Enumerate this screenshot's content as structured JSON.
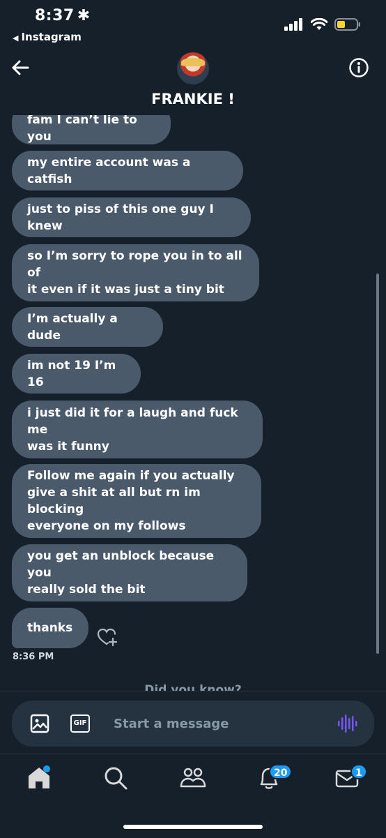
{
  "status_bar": {
    "time": "8:37",
    "back_app": "Instagram"
  },
  "header": {
    "contact_name": "FRANKIE !"
  },
  "messages": [
    {
      "text": "fam I can’t lie to you"
    },
    {
      "text": "my entire account was a catfish"
    },
    {
      "text": "just to piss of this one guy I knew"
    },
    {
      "text": "so I’m sorry to rope you in to all of\nit even if it was just a tiny bit"
    },
    {
      "text": "I’m actually a dude"
    },
    {
      "text": "im not 19 I’m 16"
    },
    {
      "text": "i just did it for a laugh and fuck me\nwas it funny"
    },
    {
      "text": "Follow me again if you actually\ngive a shit at all but rn im blocking\neveryone on my follows"
    },
    {
      "text": "you get an unblock because you\nreally sold the bit"
    },
    {
      "text": "thanks"
    }
  ],
  "last_message_time": "8:36 PM",
  "did_you_know": "Did you know?",
  "composer": {
    "placeholder": "Start a message",
    "gif_label": "GIF"
  },
  "tabbar": {
    "notifications_count": "20",
    "messages_count": "1"
  },
  "colors": {
    "background": "#15202b",
    "bubble": "#4a5a6a",
    "accent": "#1d9bf0",
    "voice": "#7856ff"
  },
  "icons": [
    "back-arrow-icon",
    "info-icon",
    "heart-plus-icon",
    "image-icon",
    "gif-icon",
    "voice-icon",
    "home-icon",
    "search-icon",
    "communities-icon",
    "bell-icon",
    "mail-icon"
  ]
}
